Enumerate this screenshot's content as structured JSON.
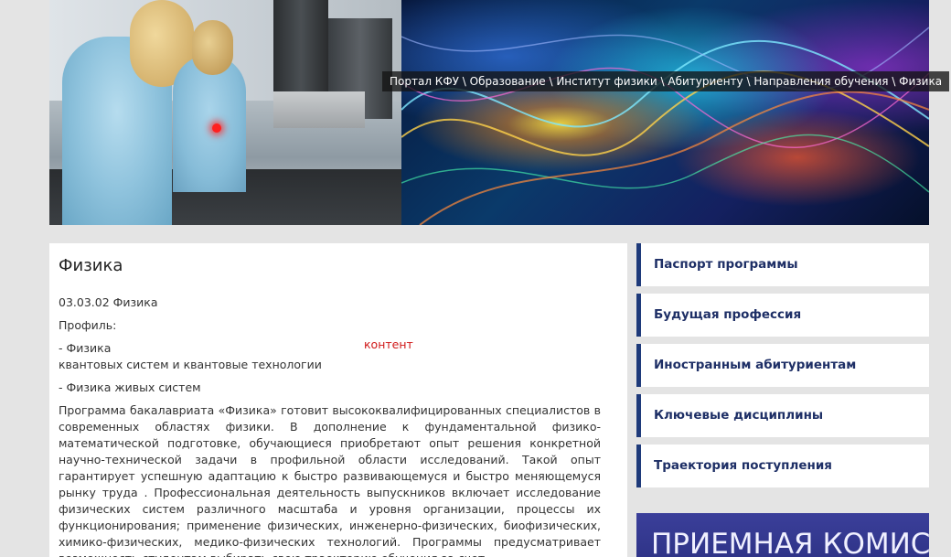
{
  "breadcrumb": {
    "items": [
      "Портал КФУ",
      "Образование",
      "Институт физики",
      "Абитуриенту",
      "Направления обучения",
      "Физика"
    ],
    "separator": " \\ "
  },
  "main": {
    "title": "Физика",
    "code": "03.03.02 Физика",
    "profile_label": "Профиль:",
    "profile_1": "- Физика",
    "profile_1_cont": "квантовых систем и квантовые технологии",
    "marker": "контент",
    "profile_2": "- Физика живых систем",
    "description": "Программа бакалавриата «Физика» готовит высококвалифицированных специалистов в современных областях физики. В дополнение к фундаментальной физико-математической подготовке, обучающиеся приобретают опыт решения конкретной научно-технической задачи в профильной области исследований. Такой опыт гарантирует успешную адаптацию к быстро развивающемуся и быстро меняющемуся рынку труда . Профессиональная деятельность выпускников включает исследование физических систем различного масштаба и уровня организации, процессы их функционирования; применение физических, инженерно-физических, биофизических, химико-физических, медико-физических технологий. Программы предусматривает возможность студентам выбирать свою траекторию обучения за счет"
  },
  "sidebar": {
    "items": [
      {
        "label": "Паспорт программы"
      },
      {
        "label": "Будущая профессия"
      },
      {
        "label": "Иностранным абитуриентам"
      },
      {
        "label": "Ключевые дисциплины"
      },
      {
        "label": "Траектория поступления"
      }
    ],
    "promo_text": "ПРИЕМНАЯ КОМИССИЯ"
  },
  "colors": {
    "sidebar_accent": "#1e3a7a",
    "sidebar_text": "#1e2f66",
    "marker": "#d01818",
    "page_bg": "#e4e4e4"
  }
}
